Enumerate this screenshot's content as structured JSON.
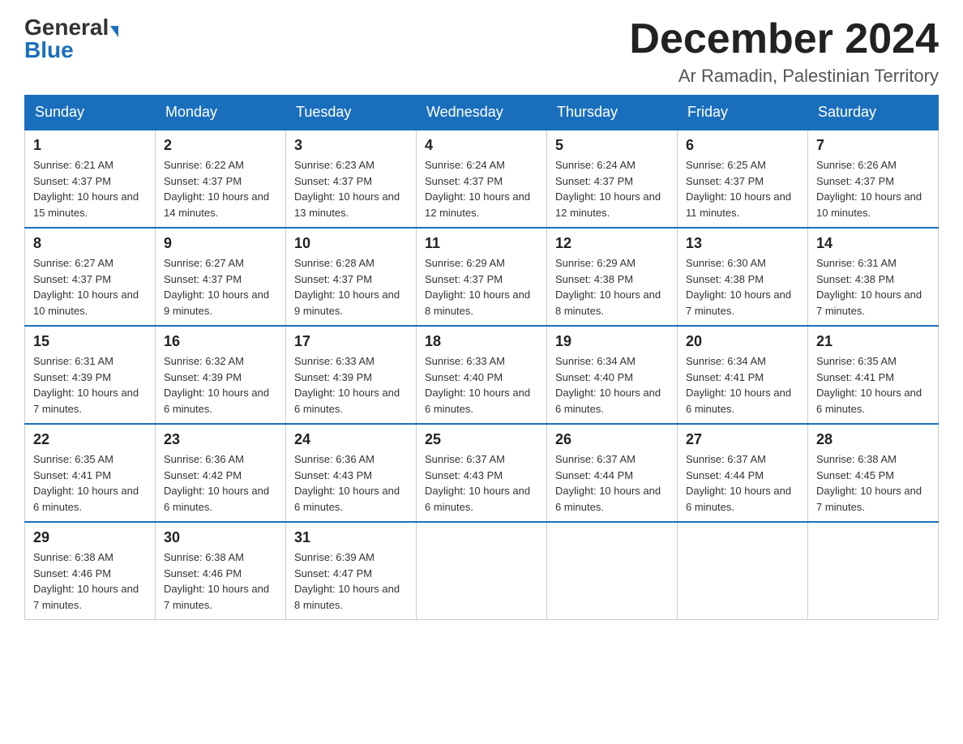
{
  "header": {
    "logo_general": "General",
    "logo_blue": "Blue",
    "month_title": "December 2024",
    "location": "Ar Ramadin, Palestinian Territory"
  },
  "weekdays": [
    "Sunday",
    "Monday",
    "Tuesday",
    "Wednesday",
    "Thursday",
    "Friday",
    "Saturday"
  ],
  "weeks": [
    [
      {
        "day": "1",
        "sunrise": "6:21 AM",
        "sunset": "4:37 PM",
        "daylight": "10 hours and 15 minutes."
      },
      {
        "day": "2",
        "sunrise": "6:22 AM",
        "sunset": "4:37 PM",
        "daylight": "10 hours and 14 minutes."
      },
      {
        "day": "3",
        "sunrise": "6:23 AM",
        "sunset": "4:37 PM",
        "daylight": "10 hours and 13 minutes."
      },
      {
        "day": "4",
        "sunrise": "6:24 AM",
        "sunset": "4:37 PM",
        "daylight": "10 hours and 12 minutes."
      },
      {
        "day": "5",
        "sunrise": "6:24 AM",
        "sunset": "4:37 PM",
        "daylight": "10 hours and 12 minutes."
      },
      {
        "day": "6",
        "sunrise": "6:25 AM",
        "sunset": "4:37 PM",
        "daylight": "10 hours and 11 minutes."
      },
      {
        "day": "7",
        "sunrise": "6:26 AM",
        "sunset": "4:37 PM",
        "daylight": "10 hours and 10 minutes."
      }
    ],
    [
      {
        "day": "8",
        "sunrise": "6:27 AM",
        "sunset": "4:37 PM",
        "daylight": "10 hours and 10 minutes."
      },
      {
        "day": "9",
        "sunrise": "6:27 AM",
        "sunset": "4:37 PM",
        "daylight": "10 hours and 9 minutes."
      },
      {
        "day": "10",
        "sunrise": "6:28 AM",
        "sunset": "4:37 PM",
        "daylight": "10 hours and 9 minutes."
      },
      {
        "day": "11",
        "sunrise": "6:29 AM",
        "sunset": "4:37 PM",
        "daylight": "10 hours and 8 minutes."
      },
      {
        "day": "12",
        "sunrise": "6:29 AM",
        "sunset": "4:38 PM",
        "daylight": "10 hours and 8 minutes."
      },
      {
        "day": "13",
        "sunrise": "6:30 AM",
        "sunset": "4:38 PM",
        "daylight": "10 hours and 7 minutes."
      },
      {
        "day": "14",
        "sunrise": "6:31 AM",
        "sunset": "4:38 PM",
        "daylight": "10 hours and 7 minutes."
      }
    ],
    [
      {
        "day": "15",
        "sunrise": "6:31 AM",
        "sunset": "4:39 PM",
        "daylight": "10 hours and 7 minutes."
      },
      {
        "day": "16",
        "sunrise": "6:32 AM",
        "sunset": "4:39 PM",
        "daylight": "10 hours and 6 minutes."
      },
      {
        "day": "17",
        "sunrise": "6:33 AM",
        "sunset": "4:39 PM",
        "daylight": "10 hours and 6 minutes."
      },
      {
        "day": "18",
        "sunrise": "6:33 AM",
        "sunset": "4:40 PM",
        "daylight": "10 hours and 6 minutes."
      },
      {
        "day": "19",
        "sunrise": "6:34 AM",
        "sunset": "4:40 PM",
        "daylight": "10 hours and 6 minutes."
      },
      {
        "day": "20",
        "sunrise": "6:34 AM",
        "sunset": "4:41 PM",
        "daylight": "10 hours and 6 minutes."
      },
      {
        "day": "21",
        "sunrise": "6:35 AM",
        "sunset": "4:41 PM",
        "daylight": "10 hours and 6 minutes."
      }
    ],
    [
      {
        "day": "22",
        "sunrise": "6:35 AM",
        "sunset": "4:41 PM",
        "daylight": "10 hours and 6 minutes."
      },
      {
        "day": "23",
        "sunrise": "6:36 AM",
        "sunset": "4:42 PM",
        "daylight": "10 hours and 6 minutes."
      },
      {
        "day": "24",
        "sunrise": "6:36 AM",
        "sunset": "4:43 PM",
        "daylight": "10 hours and 6 minutes."
      },
      {
        "day": "25",
        "sunrise": "6:37 AM",
        "sunset": "4:43 PM",
        "daylight": "10 hours and 6 minutes."
      },
      {
        "day": "26",
        "sunrise": "6:37 AM",
        "sunset": "4:44 PM",
        "daylight": "10 hours and 6 minutes."
      },
      {
        "day": "27",
        "sunrise": "6:37 AM",
        "sunset": "4:44 PM",
        "daylight": "10 hours and 6 minutes."
      },
      {
        "day": "28",
        "sunrise": "6:38 AM",
        "sunset": "4:45 PM",
        "daylight": "10 hours and 7 minutes."
      }
    ],
    [
      {
        "day": "29",
        "sunrise": "6:38 AM",
        "sunset": "4:46 PM",
        "daylight": "10 hours and 7 minutes."
      },
      {
        "day": "30",
        "sunrise": "6:38 AM",
        "sunset": "4:46 PM",
        "daylight": "10 hours and 7 minutes."
      },
      {
        "day": "31",
        "sunrise": "6:39 AM",
        "sunset": "4:47 PM",
        "daylight": "10 hours and 8 minutes."
      },
      null,
      null,
      null,
      null
    ]
  ],
  "labels": {
    "sunrise_prefix": "Sunrise: ",
    "sunset_prefix": "Sunset: ",
    "daylight_prefix": "Daylight: "
  }
}
